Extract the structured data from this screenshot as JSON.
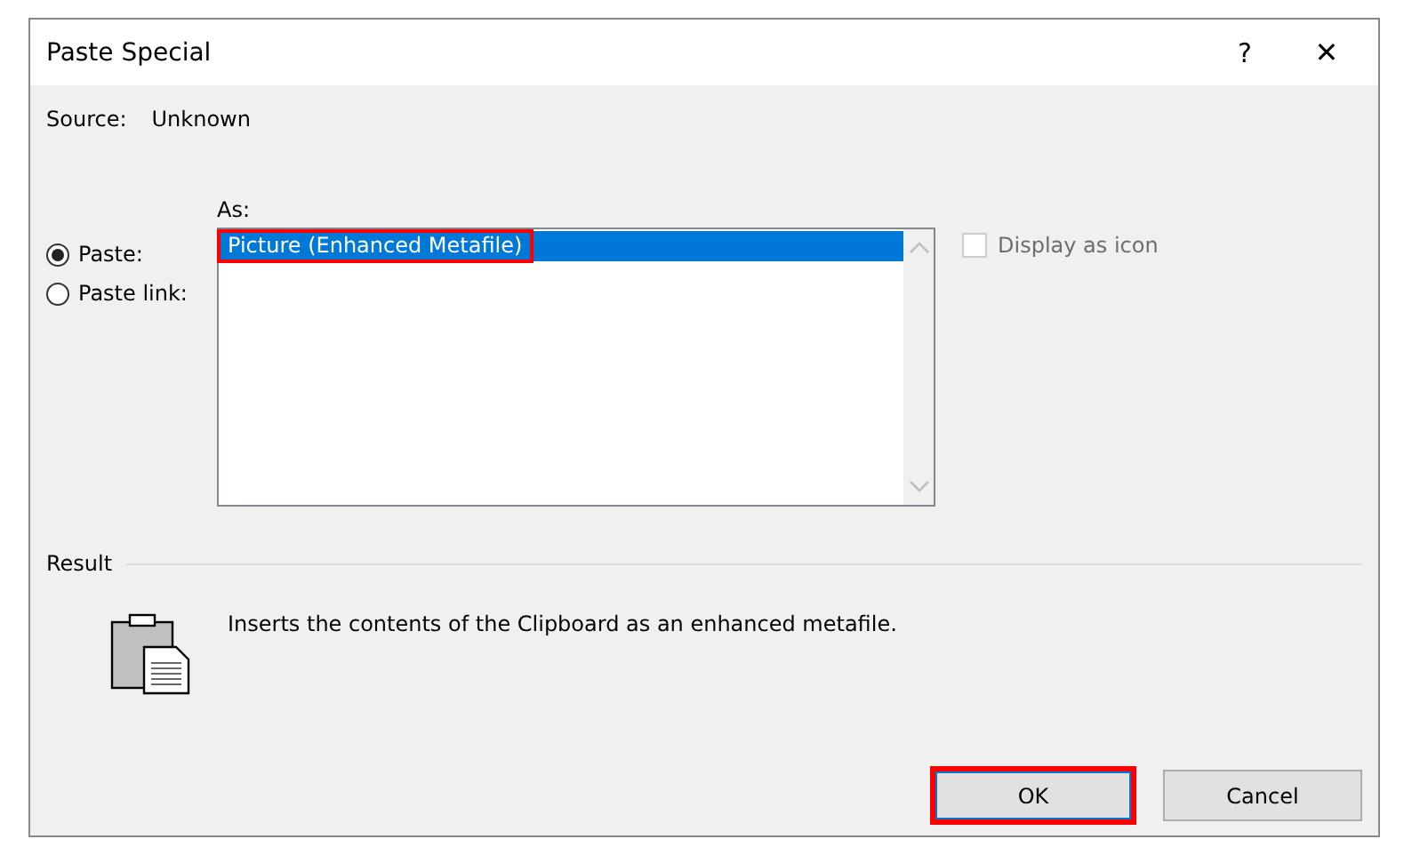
{
  "window": {
    "title": "Paste Special",
    "help_button": "?",
    "close_button": "✕"
  },
  "source": {
    "label": "Source:",
    "value": "Unknown"
  },
  "paste_options": [
    {
      "label": "Paste:",
      "selected": true
    },
    {
      "label": "Paste link:",
      "selected": false
    }
  ],
  "as_list": {
    "label": "As:",
    "items": [
      {
        "label": "Picture (Enhanced Metafile)",
        "selected": true,
        "highlighted": true
      }
    ]
  },
  "display_as_icon": {
    "label": "Display as icon",
    "checked": false,
    "disabled": true
  },
  "result": {
    "label": "Result",
    "description": "Inserts the contents of the Clipboard as an enhanced metafile."
  },
  "buttons": [
    {
      "label": "OK",
      "default": true,
      "highlighted": true
    },
    {
      "label": "Cancel",
      "default": false,
      "highlighted": false
    }
  ]
}
